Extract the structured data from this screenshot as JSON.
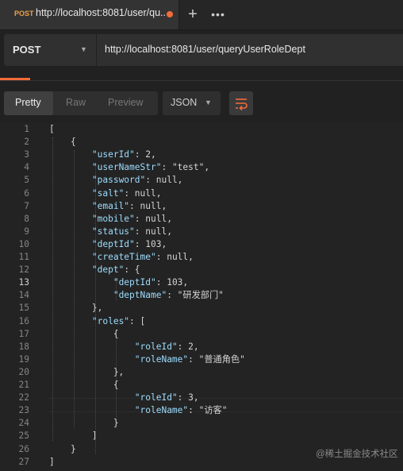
{
  "tab": {
    "method": "POST",
    "title": "http://localhost:8081/user/qu..."
  },
  "tab_add": "+",
  "tab_more": "•••",
  "request": {
    "method": "POST",
    "url": "http://localhost:8081/user/queryUserRoleDept"
  },
  "response_toolbar": {
    "pretty": "Pretty",
    "raw": "Raw",
    "preview": "Preview",
    "format": "JSON"
  },
  "code_lines": [
    "[",
    "    {",
    "        \"userId\": 2,",
    "        \"userNameStr\": \"test\",",
    "        \"password\": null,",
    "        \"salt\": null,",
    "        \"email\": null,",
    "        \"mobile\": null,",
    "        \"status\": null,",
    "        \"deptId\": 103,",
    "        \"createTime\": null,",
    "        \"dept\": {",
    "            \"deptId\": 103,",
    "            \"deptName\": \"研发部门\"",
    "        },",
    "        \"roles\": [",
    "            {",
    "                \"roleId\": 2,",
    "                \"roleName\": \"普通角色\"",
    "            },",
    "            {",
    "                \"roleId\": 3,",
    "                \"roleName\": \"访客\"",
    "            }",
    "        ]",
    "    }",
    "]"
  ],
  "active_line": 13,
  "watermark": "@稀土掘金技术社区"
}
